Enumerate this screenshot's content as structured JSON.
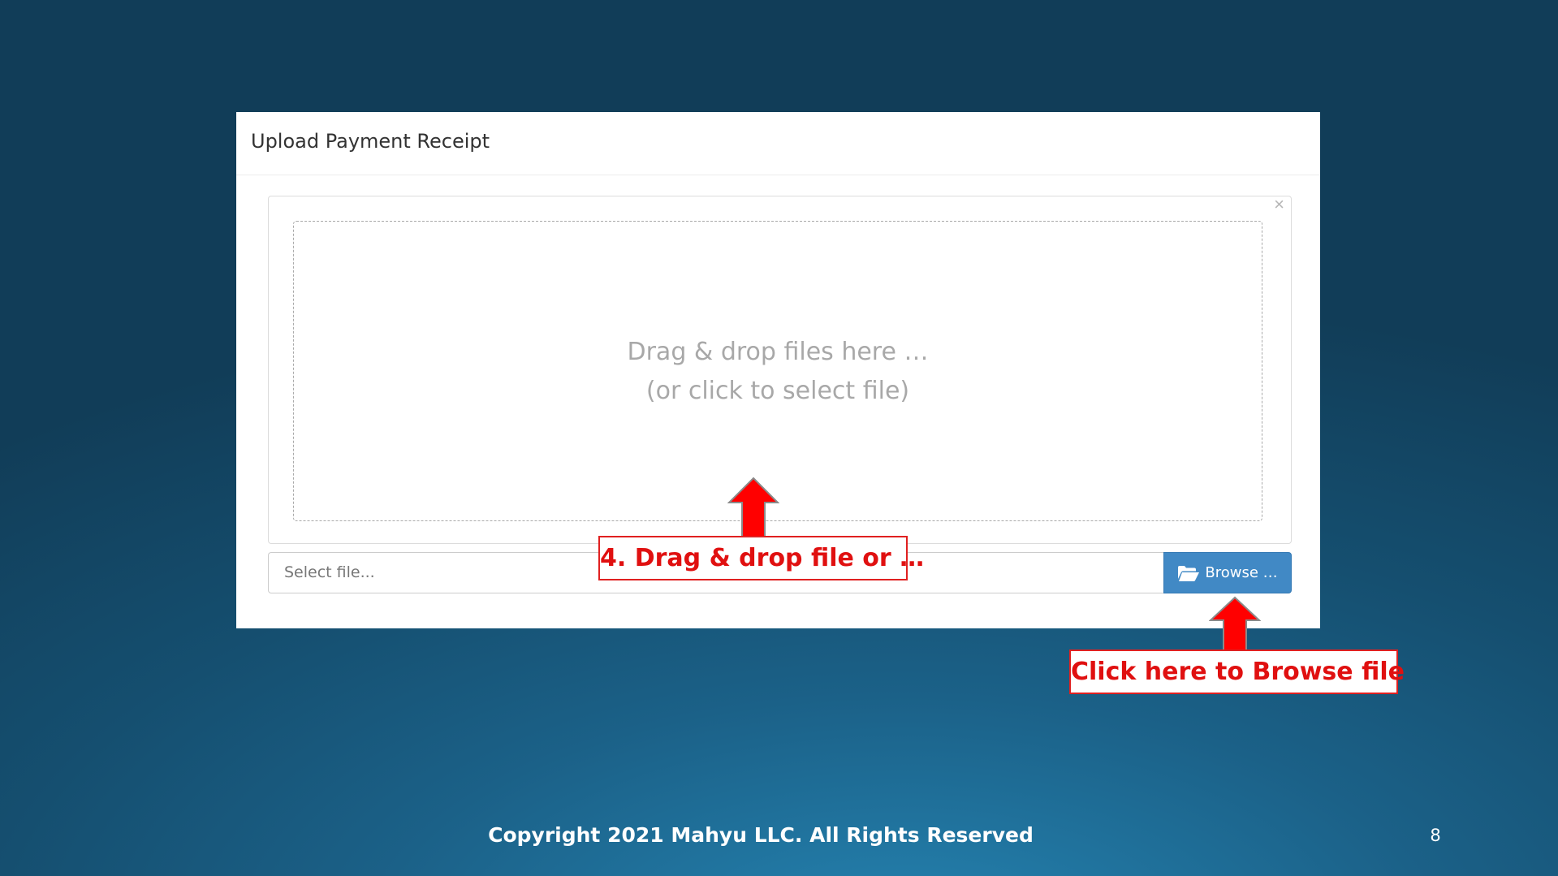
{
  "modal": {
    "title": "Upload Payment Receipt",
    "close_glyph": "×",
    "drop_zone": {
      "line1": "Drag & drop files here …",
      "line2": "(or click to select file)"
    },
    "file_input": {
      "placeholder": "Select file...",
      "browse_label": "Browse …"
    }
  },
  "annotations": {
    "drag_drop_callout": "4. Drag & drop file or …",
    "browse_callout": "Click here to Browse file",
    "color": "#e01010"
  },
  "footer": {
    "copyright": "Copyright 2021 Mahyu LLC. All Rights Reserved",
    "slide_number": "8"
  },
  "colors": {
    "browse_button": "#4189c5",
    "background": "#154f70"
  }
}
